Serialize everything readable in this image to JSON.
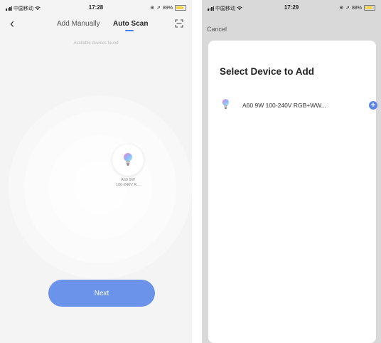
{
  "left": {
    "status": {
      "carrier": "中国移动",
      "time": "17:28",
      "battery": "89%"
    },
    "nav": {
      "back_glyph": "‹",
      "tab_manual": "Add Manually",
      "tab_auto": "Auto Scan"
    },
    "subtitle": "Available devices found",
    "device": {
      "line1": "A60 9W",
      "line2": "100-240V R..."
    },
    "next_label": "Next"
  },
  "right": {
    "status": {
      "carrier": "中国移动",
      "time": "17:29",
      "battery": "88%"
    },
    "cancel_label": "Cancel",
    "title": "Select Device to Add",
    "device": {
      "name": "A60 9W 100-240V RGB+WW...",
      "add_glyph": "+"
    }
  },
  "colors": {
    "accent": "#3d7ff2",
    "next_button": "#6c93ea",
    "add_button": "#5a86e8",
    "battery": "#f2d34a"
  }
}
